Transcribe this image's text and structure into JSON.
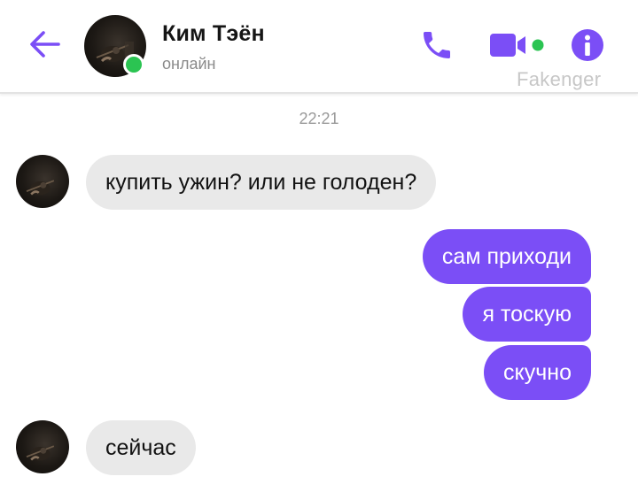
{
  "header": {
    "contact_name": "Ким Тэён",
    "contact_status": "онлайн",
    "watermark": "Fakenger",
    "icons": {
      "back": "arrow-left-icon",
      "call": "phone-icon",
      "video": "video-camera-icon",
      "info": "info-icon"
    }
  },
  "colors": {
    "accent": "#7b4ef6",
    "online": "#2bc452",
    "incoming_bubble": "#e9e9e9"
  },
  "chat": {
    "timestamp": "22:21",
    "messages": [
      {
        "direction": "incoming",
        "text": "купить ужин? или не голоден?"
      },
      {
        "direction": "outgoing",
        "text": "сам приходи"
      },
      {
        "direction": "outgoing",
        "text": "я тоскую"
      },
      {
        "direction": "outgoing",
        "text": "скучно"
      },
      {
        "direction": "incoming",
        "text": "сейчас"
      }
    ]
  }
}
